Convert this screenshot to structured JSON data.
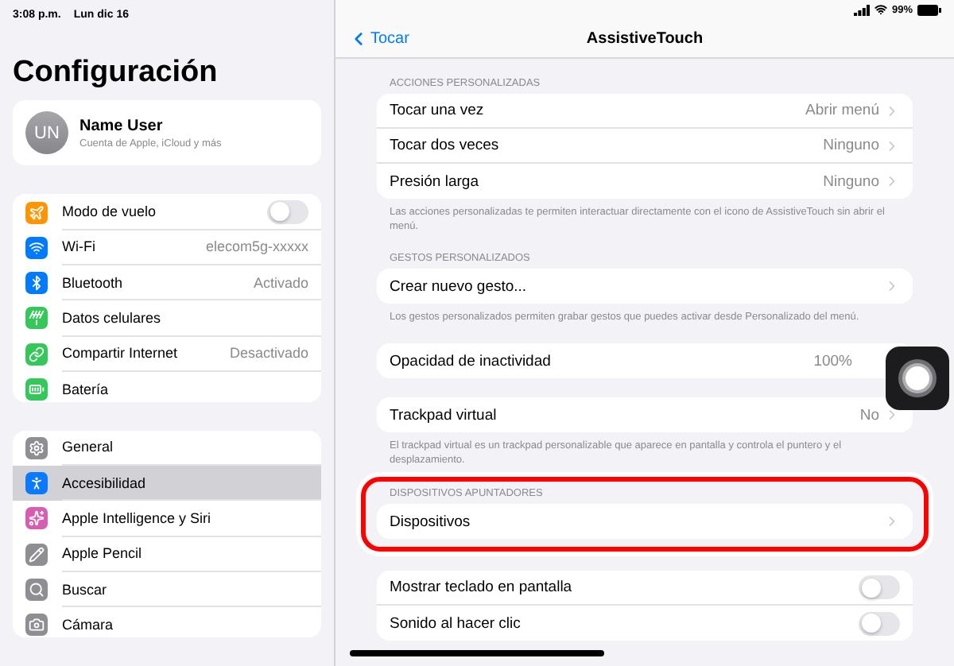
{
  "status_bar": {
    "time": "3:08 p.m.",
    "date": "Lun dic 16",
    "battery": "99%"
  },
  "sidebar": {
    "title": "Configuración",
    "profile": {
      "initials": "UN",
      "name": "Name User",
      "subtitle": "Cuenta de Apple, iCloud y más"
    },
    "groups": [
      {
        "items": [
          {
            "label": "Modo de vuelo",
            "kind": "toggle",
            "on": false,
            "color": "#ff9500",
            "selected": false
          },
          {
            "label": "Wi-Fi",
            "kind": "value",
            "value": "elecom5g-xxxxx",
            "color": "#007aff",
            "selected": false
          },
          {
            "label": "Bluetooth",
            "kind": "value",
            "value": "Activado",
            "color": "#007aff",
            "selected": false
          },
          {
            "label": "Datos celulares",
            "kind": "plain",
            "color": "#34c759",
            "selected": false
          },
          {
            "label": "Compartir Internet",
            "kind": "value",
            "value": "Desactivado",
            "color": "#34c759",
            "selected": false
          },
          {
            "label": "Batería",
            "kind": "plain",
            "color": "#34c759",
            "selected": false
          }
        ]
      },
      {
        "items": [
          {
            "label": "General",
            "kind": "plain",
            "color": "#8e8e93",
            "selected": false
          },
          {
            "label": "Accesibilidad",
            "kind": "plain",
            "color": "#0a7aff",
            "selected": true
          },
          {
            "label": "Apple Intelligence y Siri",
            "kind": "plain",
            "color": "#d65db1",
            "selected": false
          },
          {
            "label": "Apple Pencil",
            "kind": "plain",
            "color": "#8e8e93",
            "selected": false
          },
          {
            "label": "Buscar",
            "kind": "plain",
            "color": "#8e8e93",
            "selected": false
          },
          {
            "label": "Cámara",
            "kind": "plain",
            "color": "#8e8e93",
            "selected": false
          }
        ]
      }
    ]
  },
  "detail": {
    "back": "Tocar",
    "title": "AssistiveTouch",
    "sections": [
      {
        "header": "ACCIONES PERSONALIZADAS",
        "rows": [
          {
            "label": "Tocar una vez",
            "kind": "link",
            "value": "Abrir menú"
          },
          {
            "label": "Tocar dos veces",
            "kind": "link",
            "value": "Ninguno"
          },
          {
            "label": "Presión larga",
            "kind": "link",
            "value": "Ninguno"
          }
        ],
        "footer": "Las acciones personalizadas te permiten interactuar directamente con el icono de AssistiveTouch sin abrir el menú."
      },
      {
        "header": "GESTOS PERSONALIZADOS",
        "rows": [
          {
            "label": "Crear nuevo gesto...",
            "kind": "link"
          }
        ],
        "footer": "Los gestos personalizados permiten grabar gestos que puedes activar desde Personalizado del menú."
      },
      {
        "rows": [
          {
            "label": "Opacidad de inactividad",
            "kind": "value",
            "value": "100%"
          }
        ]
      },
      {
        "rows": [
          {
            "label": "Trackpad virtual",
            "kind": "link",
            "value": "No"
          }
        ],
        "footer": "El trackpad virtual es un trackpad personalizable que aparece en pantalla y controla el puntero y el desplazamiento."
      },
      {
        "header": "DISPOSITIVOS APUNTADORES",
        "highlighted": true,
        "rows": [
          {
            "label": "Dispositivos",
            "kind": "link"
          }
        ]
      },
      {
        "rows": [
          {
            "label": "Mostrar teclado en pantalla",
            "kind": "toggle",
            "on": false
          },
          {
            "label": "Sonido al hacer clic",
            "kind": "toggle",
            "on": false
          }
        ]
      }
    ]
  }
}
